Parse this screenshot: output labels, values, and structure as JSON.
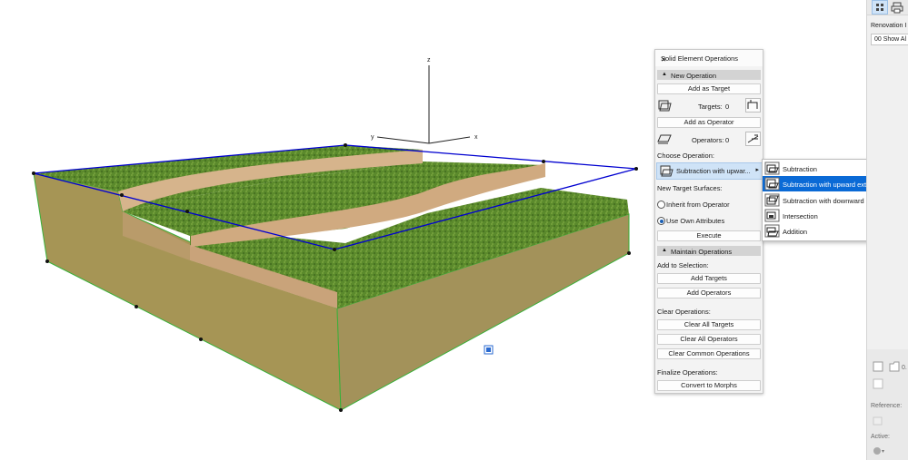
{
  "viewport": {
    "axis_labels": {
      "z": "z",
      "y": "y",
      "x": "x"
    },
    "colors": {
      "grass": "#5e8a2e",
      "soil": "#a59357",
      "soil_top": "#c9a37a",
      "selection": "#0000cc",
      "selected_edge": "#22b522"
    }
  },
  "palette": {
    "title": "Solid Element Operations",
    "close_icon": "close-icon",
    "new_operation": {
      "header": "New Operation",
      "add_target": "Add as Target",
      "targets_label": "Targets:",
      "targets_count": "0",
      "add_operator": "Add as Operator",
      "operators_label": "Operators:",
      "operators_count": "0",
      "choose_label": "Choose Operation:",
      "operation_value": "Subtraction with upwar...",
      "surfaces_label": "New Target Surfaces:",
      "inherit": "Inherit from Operator",
      "use_own": "Use Own Attributes",
      "selected_surface": "Use Own Attributes",
      "execute": "Execute"
    },
    "maintain_operations": {
      "header": "Maintain Operations",
      "add_to_selection": "Add to Selection:",
      "add_targets": "Add Targets",
      "add_operators": "Add Operators",
      "clear_label": "Clear Operations:",
      "clear_targets": "Clear All Targets",
      "clear_operators": "Clear All Operators",
      "clear_common": "Clear Common Operations",
      "finalize_label": "Finalize Operations:",
      "convert": "Convert to Morphs"
    }
  },
  "operation_menu": {
    "selected": "Subtraction with upward extrusion",
    "items": [
      {
        "label": "Subtraction",
        "icon": "subtraction-icon"
      },
      {
        "label": "Subtraction with upward extrusion",
        "icon": "subtraction-upward-icon"
      },
      {
        "label": "Subtraction with downward extrusion",
        "icon": "subtraction-downward-icon"
      },
      {
        "label": "Intersection",
        "icon": "intersection-icon"
      },
      {
        "label": "Addition",
        "icon": "addition-icon"
      }
    ]
  },
  "right_panel": {
    "renovation_label": "Renovation I",
    "renovation_value": "00 Show Al",
    "reference_label": "Reference:",
    "active_label": "Active:",
    "value_text": "0."
  }
}
